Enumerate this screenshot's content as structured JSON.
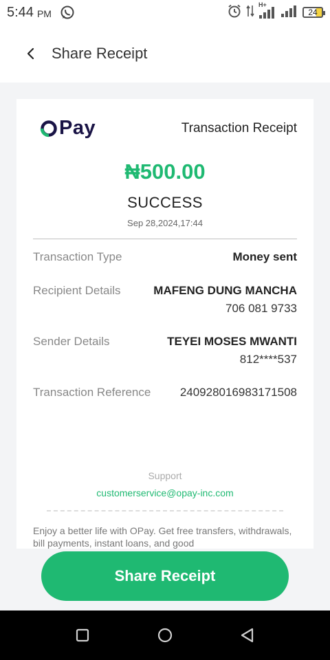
{
  "status_bar": {
    "time": "5:44",
    "ampm": "PM",
    "network": "H+",
    "battery": "24"
  },
  "header": {
    "title": "Share Receipt"
  },
  "receipt": {
    "logo_text": "Pay",
    "title": "Transaction Receipt",
    "amount": "₦500.00",
    "status": "SUCCESS",
    "datetime": "Sep 28,2024,17:44",
    "details": {
      "transaction_type": {
        "label": "Transaction Type",
        "value": "Money sent"
      },
      "recipient": {
        "label": "Recipient Details",
        "name": "MAFENG DUNG MANCHA",
        "account": "706 081 9733"
      },
      "sender": {
        "label": "Sender Details",
        "name": "TEYEI MOSES MWANTI",
        "account": "812****537"
      },
      "reference": {
        "label": "Transaction Reference",
        "value": "240928016983171508"
      }
    },
    "support_label": "Support",
    "support_email": "customerservice@opay-inc.com",
    "promo": "Enjoy a better life with OPay. Get free transfers, withdrawals, bill payments, instant loans, and good"
  },
  "share_button": {
    "label": "Share Receipt"
  },
  "colors": {
    "brand_green": "#1fb972",
    "brand_navy": "#1a1446"
  },
  "icons": [
    "whatsapp-icon",
    "alarm-icon",
    "data-arrows-icon",
    "signal-icon",
    "battery-icon",
    "back-arrow-icon",
    "opay-logo-icon",
    "recents-icon",
    "home-icon",
    "back-nav-icon"
  ]
}
